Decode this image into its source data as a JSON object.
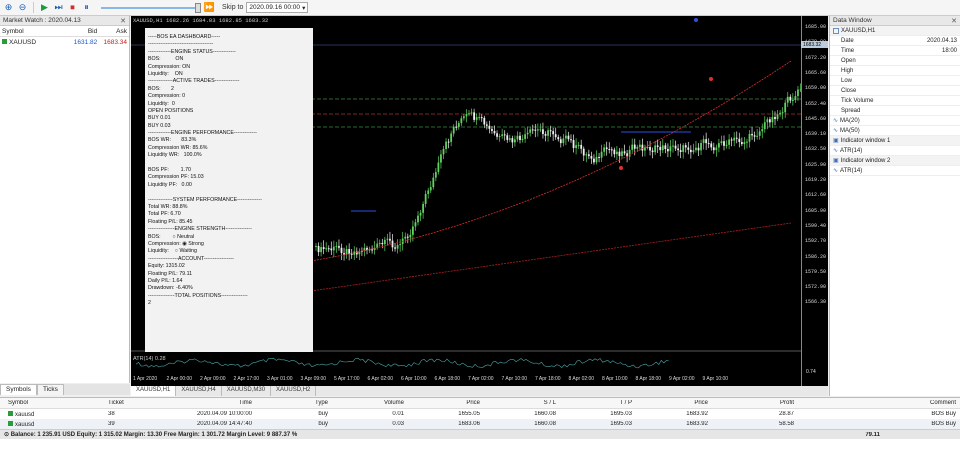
{
  "toolbar": {
    "skip_label": "Skip to",
    "skip_date": "2020.09.16 00:00"
  },
  "market_watch": {
    "title": "Market Watch : 2020.04.13",
    "headers": [
      "Symbol",
      "Bid",
      "Ask"
    ],
    "rows": [
      {
        "symbol": "XAUUSD",
        "bid": "1631.82",
        "ask": "1683.34"
      }
    ],
    "tabs": [
      "Symbols",
      "Ticks"
    ]
  },
  "chart": {
    "header": "XAUUSD,H1  1682.26 1684.03 1682.85 1683.32",
    "atr_label": "ATR(14) 0.28",
    "atr_value": "0.74",
    "current_price": "1683.32",
    "price_levels": [
      "1685.00",
      "1678.80",
      "1672.20",
      "1665.60",
      "1659.00",
      "1652.40",
      "1645.60",
      "1639.10",
      "1632.50",
      "1625.90",
      "1619.20",
      "1612.60",
      "1605.90",
      "1599.40",
      "1592.70",
      "1586.20",
      "1579.50",
      "1572.90",
      "1566.30"
    ],
    "time_labels": [
      "1 Apr 2020",
      "2 Apr 00:00",
      "2 Apr 09:00",
      "2 Apr 17:00",
      "3 Apr 01:00",
      "3 Apr 09:00",
      "5 Apr 17:00",
      "6 Apr 02:00",
      "6 Apr 10:00",
      "6 Apr 18:00",
      "7 Apr 02:00",
      "7 Apr 10:00",
      "7 Apr 18:00",
      "8 Apr 02:00",
      "8 Apr 10:00",
      "8 Apr 18:00",
      "9 Apr 02:00",
      "9 Apr 10:00"
    ],
    "tabs": [
      "XAUUSD,H1",
      "XAUUSD,H4",
      "XAUUSD,M30",
      "XAUUSD,H2"
    ]
  },
  "dashboard": {
    "lines": [
      "-----BOS EA DASHBOARD-----",
      "-------------------------------------",
      "-------------ENGINE STATUS-------------",
      "BOS:          ON",
      "Compression: ON",
      "Liquidity:    ON",
      "--------------ACTIVE TRADES--------------",
      "BOS:       2",
      "Compression: 0",
      "Liquidity:  0",
      "OPEN POSITIONS",
      "BUY 0.01",
      "BUY 0.03",
      "-------------ENGINE PERFORMANCE-------------",
      "BOS WR:       83.3%",
      "Compression WR: 85.6%",
      "Liquidity WR:   100.0%",
      "",
      "BOS PF:        1.70",
      "Compression PF: 15.03",
      "Liquidity PF:   0.00",
      "",
      "--------------SYSTEM PERFORMANCE--------------",
      "Total WR: 88.8%",
      "Total PF: 6.70",
      "Floating P/L: 85.45",
      "---------------ENGINE STRENGTH---------------",
      "BOS:        ○ Neutral",
      "Compression: ◉ Strong",
      "Liquidity:    ○ Waiting",
      "-----------------ACCOUNT-----------------",
      "Equity: 1315.02",
      "Floating P/L: 79.11",
      "Daily P/L: 1.64",
      "Drawdown: -6.40%",
      "---------------TOTAL POSITIONS---------------",
      "2"
    ]
  },
  "data_window": {
    "title": "Data Window",
    "symbol": "XAUUSD,H1",
    "rows": [
      {
        "k": "Date",
        "v": "2020.04.13"
      },
      {
        "k": "Time",
        "v": "18:00"
      },
      {
        "k": "Open",
        "v": ""
      },
      {
        "k": "High",
        "v": ""
      },
      {
        "k": "Low",
        "v": ""
      },
      {
        "k": "Close",
        "v": ""
      },
      {
        "k": "Tick Volume",
        "v": ""
      },
      {
        "k": "Spread",
        "v": ""
      }
    ],
    "indicators": [
      "MA(20)",
      "MA(50)",
      "Indicator window 1",
      "ATR(14)",
      "Indicator window 2",
      "ATR(14)"
    ]
  },
  "terminal": {
    "headers": [
      "Symbol",
      "Ticket",
      "Time",
      "Type",
      "Volume",
      "Price",
      "S / L",
      "T / P",
      "Price",
      "Profit",
      "Comment"
    ],
    "rows": [
      {
        "symbol": "xauusd",
        "ticket": "38",
        "time": "2020.04.09 10:00:00",
        "type": "buy",
        "volume": "0.01",
        "price": "1655.05",
        "sl": "1660.08",
        "tp": "1695.03",
        "cur": "1683.92",
        "profit": "28.87",
        "comment": "BOS Buy"
      },
      {
        "symbol": "xauusd",
        "ticket": "39",
        "time": "2020.04.09 14:47:40",
        "type": "buy",
        "volume": "0.03",
        "price": "1683.06",
        "sl": "1660.08",
        "tp": "1695.03",
        "cur": "1683.92",
        "profit": "58.58",
        "comment": "BOS Buy"
      }
    ],
    "balance": "Balance: 1 235.91 USD  Equity: 1 315.02  Margin: 13.30  Free Margin: 1 301.72  Margin Level: 9 887.37 %",
    "total_profit": "79.11"
  }
}
